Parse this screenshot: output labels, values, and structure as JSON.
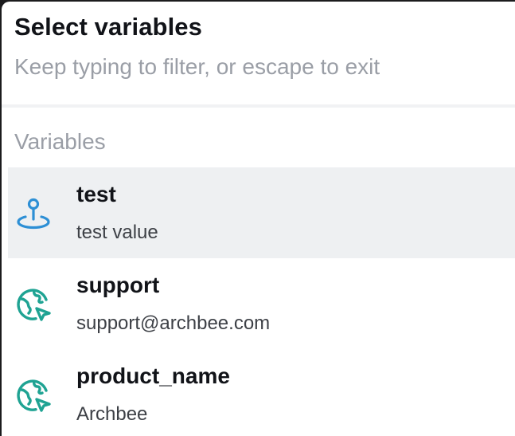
{
  "header": {
    "title": "Select variables",
    "subtitle": "Keep typing to filter, or escape to exit"
  },
  "section": {
    "label": "Variables"
  },
  "variables": [
    {
      "name": "test",
      "value": "test value",
      "icon": "map-pin-icon",
      "selected": true,
      "icon_color": "#2d8fd5"
    },
    {
      "name": "support",
      "value": "support@archbee.com",
      "icon": "globe-icon",
      "selected": false,
      "icon_color": "#1fa393"
    },
    {
      "name": "product_name",
      "value": "Archbee",
      "icon": "globe-icon",
      "selected": false,
      "icon_color": "#1fa393"
    }
  ],
  "colors": {
    "selected_background": "#eef0f2",
    "title": "#111318",
    "muted_text": "#9a9ea6"
  }
}
